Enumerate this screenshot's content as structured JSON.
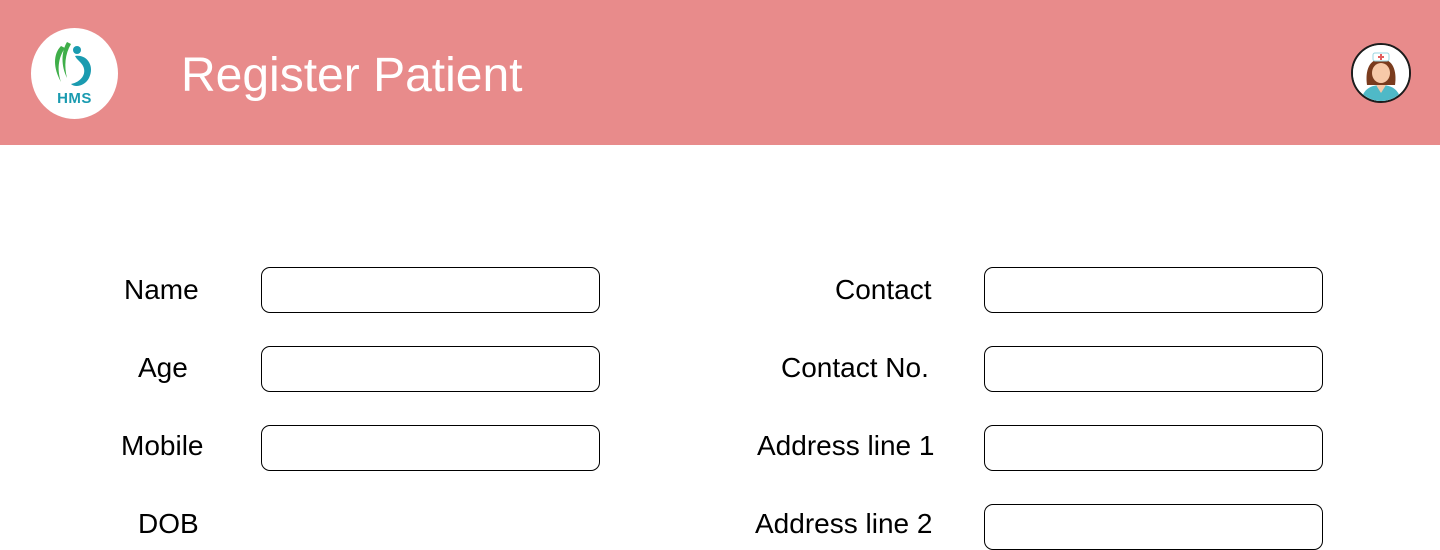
{
  "header": {
    "logo_text": "HMS",
    "title": "Register Patient",
    "background_color": "#e88b8b",
    "avatar_icon": "nurse-avatar-icon"
  },
  "form": {
    "left": [
      {
        "label": "Name",
        "value": "",
        "placeholder": ""
      },
      {
        "label": "Age",
        "value": "",
        "placeholder": ""
      },
      {
        "label": "Mobile",
        "value": "",
        "placeholder": ""
      },
      {
        "label": "DOB"
      }
    ],
    "right": [
      {
        "label": "Contact",
        "value": "",
        "placeholder": ""
      },
      {
        "label": "Contact No.",
        "value": "",
        "placeholder": ""
      },
      {
        "label": "Address line 1",
        "value": "",
        "placeholder": ""
      },
      {
        "label": "Address line 2",
        "value": "",
        "placeholder": ""
      }
    ]
  }
}
